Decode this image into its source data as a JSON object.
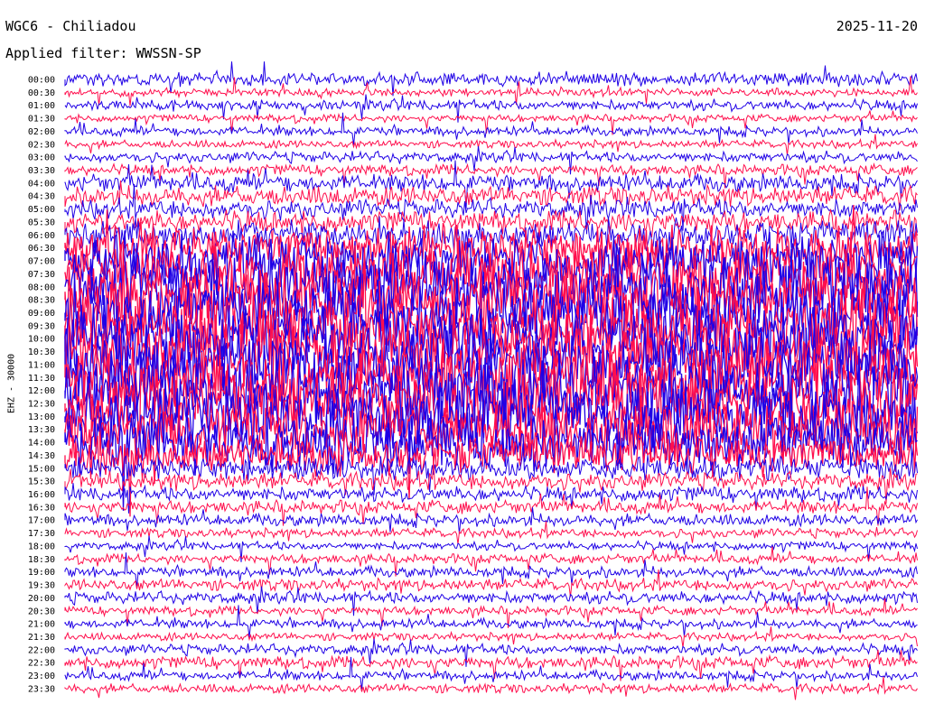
{
  "header": {
    "station": "WGC6 - Chiliadou",
    "date": "2025-11-20",
    "filter": "Applied filter: WWSSN-SP"
  },
  "channel_label": "EHZ - 30000",
  "colors": {
    "even": "#1f00e6",
    "odd": "#ff0f4d"
  },
  "chart_data": {
    "type": "line",
    "title": "WGC6 - Chiliadou",
    "subtitle": "Applied filter: WWSSN-SP",
    "ylabel": "EHZ - 30000",
    "xlabel": "",
    "row_labels": [
      "00:00",
      "00:30",
      "01:00",
      "01:30",
      "02:00",
      "02:30",
      "03:00",
      "03:30",
      "04:00",
      "04:30",
      "05:00",
      "05:30",
      "06:00",
      "06:30",
      "07:00",
      "07:30",
      "08:00",
      "08:30",
      "09:00",
      "09:30",
      "10:00",
      "10:30",
      "11:00",
      "11:30",
      "12:00",
      "12:30",
      "13:00",
      "13:30",
      "14:00",
      "14:30",
      "15:00",
      "15:30",
      "16:00",
      "16:30",
      "17:00",
      "17:30",
      "18:00",
      "18:30",
      "19:00",
      "19:30",
      "20:00",
      "20:30",
      "21:00",
      "21:30",
      "22:00",
      "22:30",
      "23:00",
      "23:30"
    ],
    "activity": [
      0.16,
      0.08,
      0.12,
      0.07,
      0.1,
      0.08,
      0.12,
      0.12,
      0.22,
      0.25,
      0.25,
      0.28,
      0.4,
      0.6,
      0.75,
      0.92,
      1,
      1,
      1,
      1,
      1,
      1,
      1,
      1,
      1,
      1,
      0.95,
      0.9,
      0.85,
      0.55,
      0.3,
      0.22,
      0.18,
      0.15,
      0.14,
      0.1,
      0.09,
      0.1,
      0.12,
      0.14,
      0.14,
      0.09,
      0.1,
      0.08,
      0.12,
      0.14,
      0.1,
      0.1
    ],
    "legend": "none",
    "grid": false
  }
}
